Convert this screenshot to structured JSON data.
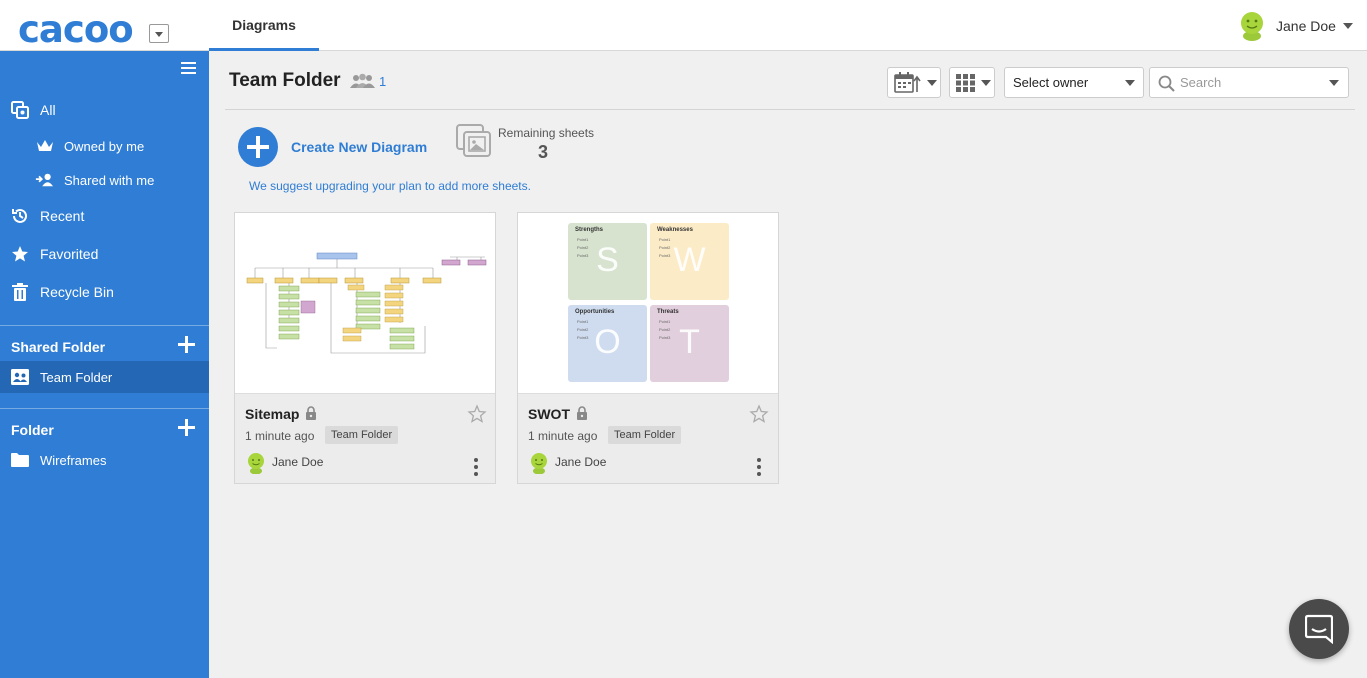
{
  "app": {
    "logo_text": "cacoo"
  },
  "header": {
    "tab_label": "Diagrams",
    "user_name": "Jane Doe"
  },
  "sidebar": {
    "items": [
      {
        "label": "All",
        "icon": "copy-icon"
      },
      {
        "label": "Owned by me",
        "icon": "crown-icon"
      },
      {
        "label": "Shared with me",
        "icon": "shared-user-icon"
      },
      {
        "label": "Recent",
        "icon": "history-icon"
      },
      {
        "label": "Favorited",
        "icon": "star-icon"
      },
      {
        "label": "Recycle Bin",
        "icon": "trash-icon"
      }
    ],
    "shared_folder_header": "Shared Folder",
    "shared_folders": [
      {
        "label": "Team Folder",
        "active": true
      }
    ],
    "folder_header": "Folder",
    "folders": [
      {
        "label": "Wireframes"
      }
    ]
  },
  "main": {
    "folder_title": "Team Folder",
    "member_count": "1",
    "owner_select": "Select owner",
    "search_placeholder": "Search",
    "create_label": "Create New Diagram",
    "remaining_label": "Remaining sheets",
    "remaining_count": "3",
    "upgrade_note": "We suggest upgrading your plan to add more sheets."
  },
  "cards": [
    {
      "name": "Sitemap",
      "time": "1 minute ago",
      "tag": "Team Folder",
      "owner": "Jane Doe"
    },
    {
      "name": "SWOT",
      "time": "1 minute ago",
      "tag": "Team Folder",
      "owner": "Jane Doe"
    }
  ],
  "swot": {
    "quadrants": [
      {
        "title": "Strengths",
        "letter": "S",
        "color": "#d7e3cf"
      },
      {
        "title": "Weaknesses",
        "letter": "W",
        "color": "#fcebc7"
      },
      {
        "title": "Opportunities",
        "letter": "O",
        "color": "#cfdcef"
      },
      {
        "title": "Threats",
        "letter": "T",
        "color": "#e2cfdd"
      }
    ],
    "bullets": [
      "Point1",
      "Point2",
      "Point3"
    ]
  },
  "colors": {
    "brand": "#2f7dd4",
    "sidebar_active": "#2468b5"
  }
}
